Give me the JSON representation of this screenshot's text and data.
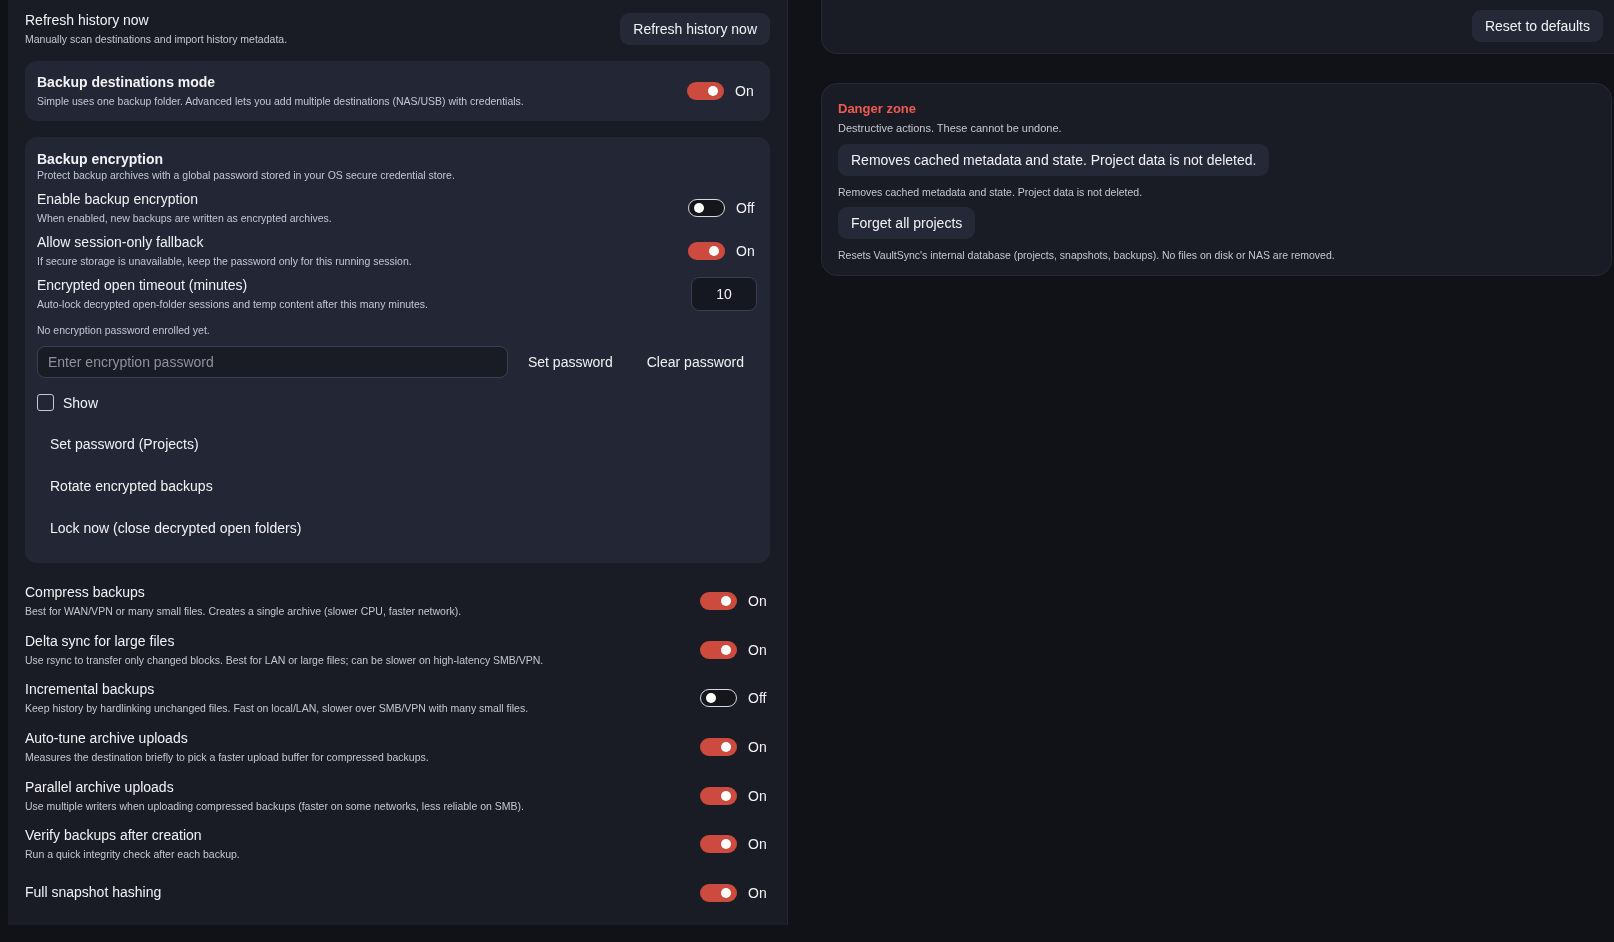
{
  "history_row": {
    "title": "Refresh history now",
    "description": "Manually scan destinations and import history metadata.",
    "button": "Refresh history now"
  },
  "destinations_mode": {
    "title": "Backup destinations mode",
    "description": "Simple uses one backup folder. Advanced lets you add multiple destinations (NAS/USB) with credentials.",
    "on": true,
    "state_label": "On"
  },
  "encryption": {
    "title": "Backup encryption",
    "description": "Protect backup archives with a global password stored in your OS secure credential store.",
    "settings": [
      {
        "kind": "toggle",
        "title": "Enable backup encryption",
        "description": "When enabled, new backups are written as encrypted archives.",
        "on": false,
        "state_label": "Off"
      },
      {
        "kind": "toggle",
        "title": "Allow session-only fallback",
        "description": "If secure storage is unavailable, keep the password only for this running session.",
        "on": true,
        "state_label": "On"
      },
      {
        "kind": "number",
        "title": "Encrypted open timeout (minutes)",
        "description": "Auto-lock decrypted open-folder sessions and temp content after this many minutes.",
        "value": "10"
      }
    ],
    "status": "No encryption password enrolled yet.",
    "password_field": {
      "placeholder": "Enter encryption password"
    },
    "set_button": "Set password",
    "clear_button": "Clear password",
    "show_checkbox": {
      "label": "Show",
      "checked": false
    },
    "actions": [
      "Set password (Projects)",
      "Rotate encrypted backups",
      "Lock now (close decrypted open folders)"
    ]
  },
  "settings": [
    {
      "title": "Compress backups",
      "description": "Best for WAN/VPN or many small files. Creates a single archive (slower CPU, faster network).",
      "on": true,
      "state_label": "On"
    },
    {
      "title": "Delta sync for large files",
      "description": "Use rsync to transfer only changed blocks. Best for LAN or large files; can be slower on high-latency SMB/VPN.",
      "on": true,
      "state_label": "On"
    },
    {
      "title": "Incremental backups",
      "description": "Keep history by hardlinking unchanged files. Fast on local/LAN, slower over SMB/VPN with many small files.",
      "on": false,
      "state_label": "Off"
    },
    {
      "title": "Auto-tune archive uploads",
      "description": "Measures the destination briefly to pick a faster upload buffer for compressed backups.",
      "on": true,
      "state_label": "On"
    },
    {
      "title": "Parallel archive uploads",
      "description": "Use multiple writers when uploading compressed backups (faster on some networks, less reliable on SMB).",
      "on": true,
      "state_label": "On"
    },
    {
      "title": "Verify backups after creation",
      "description": "Run a quick integrity check after each backup.",
      "on": true,
      "state_label": "On"
    },
    {
      "title": "Full snapshot hashing",
      "on": true,
      "state_label": "On"
    }
  ],
  "reset_button": "Reset to defaults",
  "danger_zone": {
    "title": "Danger zone",
    "description": "Destructive actions. These cannot be undone.",
    "actions": [
      {
        "button": "Removes cached metadata and state. Project data is not deleted.",
        "note": "Removes cached metadata and state. Project data is not deleted."
      },
      {
        "button": "Forget all projects",
        "note": "Resets VaultSync's internal database (projects, snapshots, backups). No files on disk or NAS are removed."
      }
    ]
  }
}
